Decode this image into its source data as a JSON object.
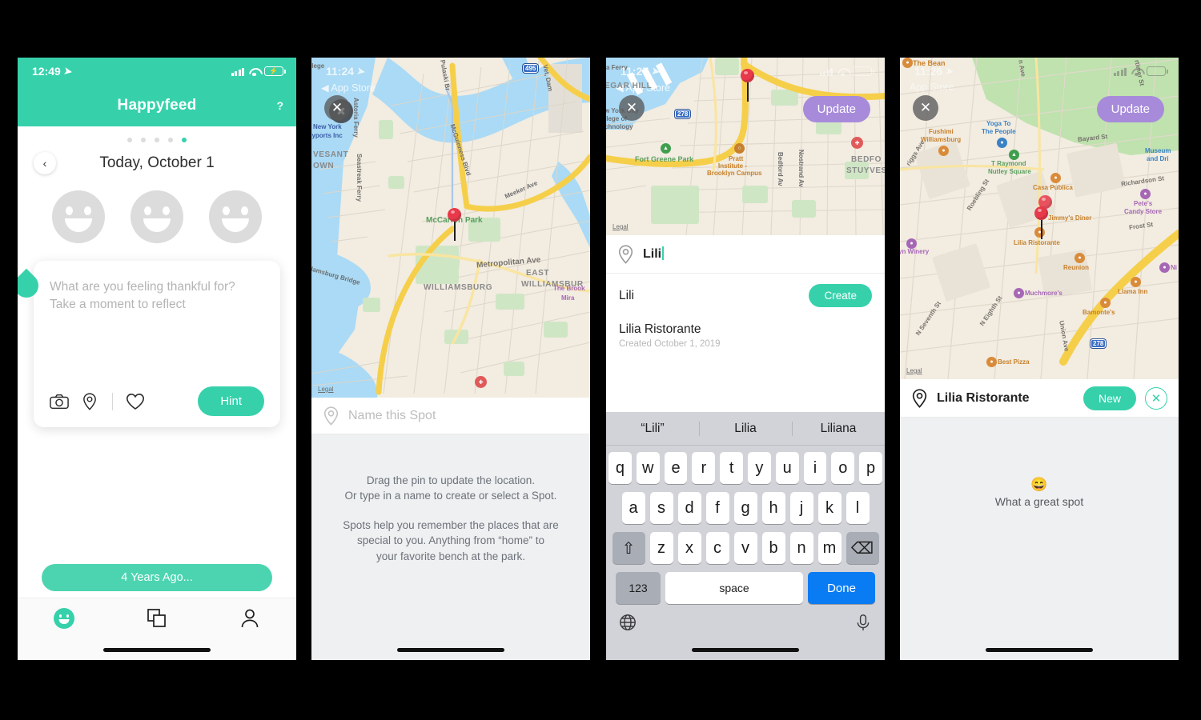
{
  "theme": {
    "teal": "#36d1ab",
    "teal_secondary": "#4cd4b0",
    "purple": "#a78bda",
    "blue_key": "#0a7cf3",
    "pin_red": "#e8394a"
  },
  "screen1": {
    "status": {
      "time": "12:49",
      "location_icon": "location-arrow-icon",
      "signal": "cellular-signal-icon",
      "wifi": "wifi-icon",
      "battery": "battery-charging-icon"
    },
    "header": {
      "title": "Happyfeed",
      "help_label": "?"
    },
    "pager": {
      "total": 5,
      "active_index": 4
    },
    "date": {
      "back_label": "‹",
      "label": "Today, October 1"
    },
    "moods": [
      {
        "name": "mood-face-1"
      },
      {
        "name": "mood-face-2"
      },
      {
        "name": "mood-face-3"
      }
    ],
    "entry_card": {
      "placeholder_line1": "What are you feeling thankful for?",
      "placeholder_line2": "Take a moment to reflect",
      "tools": [
        "camera-icon",
        "location-pin-icon",
        "heart-icon"
      ],
      "hint_label": "Hint"
    },
    "memory_button": "4 Years Ago...",
    "tabs": [
      {
        "name": "tab-journal",
        "icon": "smiley-icon",
        "active": true
      },
      {
        "name": "tab-cards",
        "icon": "stacked-cards-icon",
        "active": false
      },
      {
        "name": "tab-profile",
        "icon": "person-icon",
        "active": false
      }
    ]
  },
  "screen2": {
    "status": {
      "time": "11:24",
      "back_app": "◀ App Store"
    },
    "close_label": "✕",
    "map": {
      "labels": [
        "llege",
        "New York",
        "kyports Inc",
        "VESANT",
        "OWN",
        "Astoria Ferry",
        "Seastreak Ferry",
        "Pulaski Br",
        "McGuinness Blvd",
        "Meeker Ave",
        "Metropolitan Ave",
        "McCarren Park",
        "WILLIAMSBURG",
        "EAST",
        "WILLIAMSBUR",
        "The Brook",
        "Mira",
        "llamsburg Bridge",
        "Vet, Dam",
        "495",
        "Legal"
      ]
    },
    "spot_placeholder": "Name this Spot",
    "help": [
      "Drag the pin to update the location.\nOr type in a name to create or select a Spot.",
      "Spots help you remember the places that are special to you. Anything from “home” to your favorite bench at the park."
    ]
  },
  "screen3": {
    "status": {
      "time": "11:27",
      "back_app": "◀ App Store"
    },
    "close_label": "✕",
    "update_label": "Update",
    "map": {
      "labels": [
        "a Ferry",
        "EGAR HILL",
        "w York City",
        "llege of",
        "chnology",
        "Fort Greene Park",
        "Pratt",
        "Institute -",
        "Brooklyn Campus",
        "Bedford Av",
        "Nostrand Av",
        "BEDFO",
        "STUYVES",
        "278",
        "Legal"
      ]
    },
    "spot_value": "Lili",
    "results": [
      {
        "name": "Lili",
        "action": "Create",
        "sub": ""
      },
      {
        "name": "Lilia Ristorante",
        "action": "",
        "sub": "Created October 1, 2019"
      }
    ],
    "keyboard": {
      "suggestions": [
        "“Lili”",
        "Lilia",
        "Liliana"
      ],
      "row1": [
        "q",
        "w",
        "e",
        "r",
        "t",
        "y",
        "u",
        "i",
        "o",
        "p"
      ],
      "row2": [
        "a",
        "s",
        "d",
        "f",
        "g",
        "h",
        "j",
        "k",
        "l"
      ],
      "row3": [
        "z",
        "x",
        "c",
        "v",
        "b",
        "n",
        "m"
      ],
      "shift_label": "⇧",
      "backspace_label": "⌫",
      "numbers_label": "123",
      "space_label": "space",
      "done_label": "Done",
      "globe_icon": "globe-icon",
      "mic_icon": "microphone-icon"
    }
  },
  "screen4": {
    "status": {
      "time": "11:26",
      "back_app": "App Store"
    },
    "close_label": "✕",
    "update_label": "Update",
    "map": {
      "labels": [
        "The Bean",
        "Fushimi",
        "Williamsburg",
        "Yoga To",
        "The People",
        "T Raymond",
        "Nutley Square",
        "Casa Publica",
        "Bayard St",
        "Richardson St",
        "Frost St",
        "Museum",
        "and Dri",
        "Pete's",
        "Candy Store",
        "Jimmy's Diner",
        "Lilia Ristorante",
        "Reunion",
        "Muchmore's",
        "Llama Inn",
        "Bamonte's",
        "Best Pizza",
        "yn Winery",
        "Roebling St",
        "riggs Ave",
        "N Eighth St",
        "N Seventh St",
        "Union Ave",
        "rtimer St",
        "n Ave",
        "Ni",
        "278",
        "Legal"
      ]
    },
    "spot_name": "Lilia Ristorante",
    "new_label": "New",
    "close_spot_label": "✕",
    "note_emoji": "😄",
    "note_text": "What a great spot"
  }
}
